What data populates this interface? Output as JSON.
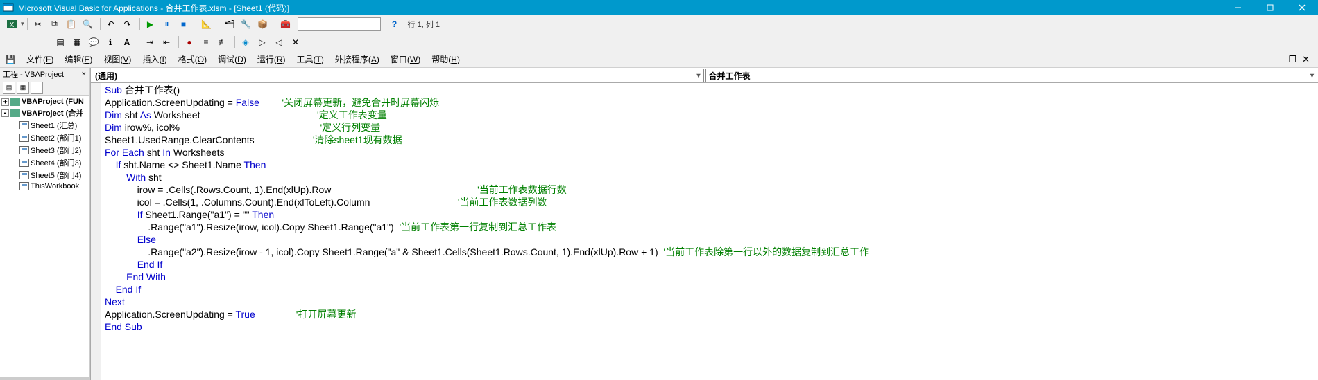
{
  "titlebar": {
    "app": "Microsoft Visual Basic for Applications",
    "doc": "合并工作表.xlsm",
    "sub": "[Sheet1 (代码)]"
  },
  "position_label": "行 1, 列 1",
  "menus": {
    "file": {
      "label": "文件",
      "key": "F"
    },
    "edit": {
      "label": "编辑",
      "key": "E"
    },
    "view": {
      "label": "视图",
      "key": "V"
    },
    "insert": {
      "label": "插入",
      "key": "I"
    },
    "format": {
      "label": "格式",
      "key": "O"
    },
    "debug": {
      "label": "调试",
      "key": "D"
    },
    "run": {
      "label": "运行",
      "key": "R"
    },
    "tools": {
      "label": "工具",
      "key": "T"
    },
    "addins": {
      "label": "外接程序",
      "key": "A"
    },
    "window": {
      "label": "窗口",
      "key": "W"
    },
    "help": {
      "label": "帮助",
      "key": "H"
    }
  },
  "project_panel": {
    "title": "工程 - VBAProject",
    "nodes": [
      {
        "level": 1,
        "exp": "+",
        "icon": "vba",
        "label": "VBAProject (FUN"
      },
      {
        "level": 1,
        "exp": "-",
        "icon": "vba",
        "label": "VBAProject (合并"
      },
      {
        "level": 2,
        "icon": "sheet",
        "label": "Sheet1 (汇总)"
      },
      {
        "level": 2,
        "icon": "sheet",
        "label": "Sheet2 (部门1)"
      },
      {
        "level": 2,
        "icon": "sheet",
        "label": "Sheet3 (部门2)"
      },
      {
        "level": 2,
        "icon": "sheet",
        "label": "Sheet4 (部门3)"
      },
      {
        "level": 2,
        "icon": "sheet",
        "label": "Sheet5 (部门4)"
      },
      {
        "level": 2,
        "icon": "sheet",
        "label": "ThisWorkbook"
      }
    ]
  },
  "code_dropdown_left": "(通用)",
  "code_dropdown_right": "合并工作表",
  "code_lines": [
    [
      {
        "t": "Sub",
        "c": "kw"
      },
      {
        "t": " 合并工作表()"
      }
    ],
    [
      {
        "t": "Application.ScreenUpdating = "
      },
      {
        "t": "False",
        "c": "kw"
      },
      {
        "t": "    "
      },
      {
        "t": "'关闭屏幕更新，避免合并时屏幕闪烁",
        "c": "cm",
        "col": 40
      }
    ],
    [
      {
        "t": "Dim",
        "c": "kw"
      },
      {
        "t": " sht "
      },
      {
        "t": "As",
        "c": "kw"
      },
      {
        "t": " Worksheet"
      },
      {
        "t": "'定义工作表变量",
        "c": "cm",
        "col": 40
      }
    ],
    [
      {
        "t": "Dim",
        "c": "kw"
      },
      {
        "t": " irow%, icol%"
      },
      {
        "t": "'定义行列变量",
        "c": "cm",
        "col": 40
      }
    ],
    [
      {
        "t": "Sheet1.UsedRange.ClearContents"
      },
      {
        "t": "'清除sheet1现有数据",
        "c": "cm",
        "col": 40
      }
    ],
    [
      {
        "t": "For Each",
        "c": "kw"
      },
      {
        "t": " sht "
      },
      {
        "t": "In",
        "c": "kw"
      },
      {
        "t": " Worksheets"
      }
    ],
    [
      {
        "t": "    "
      },
      {
        "t": "If",
        "c": "kw"
      },
      {
        "t": " sht.Name <> Sheet1.Name "
      },
      {
        "t": "Then",
        "c": "kw"
      }
    ],
    [
      {
        "t": "        "
      },
      {
        "t": "With",
        "c": "kw"
      },
      {
        "t": " sht"
      }
    ],
    [
      {
        "t": "            irow = .Cells(.Rows.Count, 1).End(xlUp).Row"
      },
      {
        "t": "'当前工作表数据行数",
        "c": "cm",
        "col": 80
      }
    ],
    [
      {
        "t": "            icol = .Cells(1, .Columns.Count).End(xlToLeft).Column"
      },
      {
        "t": "'当前工作表数据列数",
        "c": "cm",
        "col": 80
      }
    ],
    [
      {
        "t": "            "
      },
      {
        "t": "If",
        "c": "kw"
      },
      {
        "t": " Sheet1.Range(\"a1\") = \"\" "
      },
      {
        "t": "Then",
        "c": "kw"
      }
    ],
    [
      {
        "t": "                .Range(\"a1\").Resize(irow, icol).Copy Sheet1.Range(\"a1\")  "
      },
      {
        "t": "'当前工作表第一行复制到汇总工作表",
        "c": "cm"
      }
    ],
    [
      {
        "t": "            "
      },
      {
        "t": "Else",
        "c": "kw"
      }
    ],
    [
      {
        "t": "                .Range(\"a2\").Resize(irow - 1, icol).Copy Sheet1.Range(\"a\" & Sheet1.Cells(Sheet1.Rows.Count, 1).End(xlUp).Row + 1)  "
      },
      {
        "t": "'当前工作表除第一行以外的数据复制到汇总工作",
        "c": "cm"
      }
    ],
    [
      {
        "t": "            "
      },
      {
        "t": "End If",
        "c": "kw"
      }
    ],
    [
      {
        "t": "        "
      },
      {
        "t": "End With",
        "c": "kw"
      }
    ],
    [
      {
        "t": "    "
      },
      {
        "t": "End If",
        "c": "kw"
      }
    ],
    [
      {
        "t": "Next",
        "c": "kw"
      }
    ],
    [
      {
        "t": "Application.ScreenUpdating = "
      },
      {
        "t": "True",
        "c": "kw"
      },
      {
        "t": "'打开屏幕更新",
        "c": "cm",
        "col": 40
      }
    ],
    [
      {
        "t": "End Sub",
        "c": "kw"
      }
    ]
  ]
}
